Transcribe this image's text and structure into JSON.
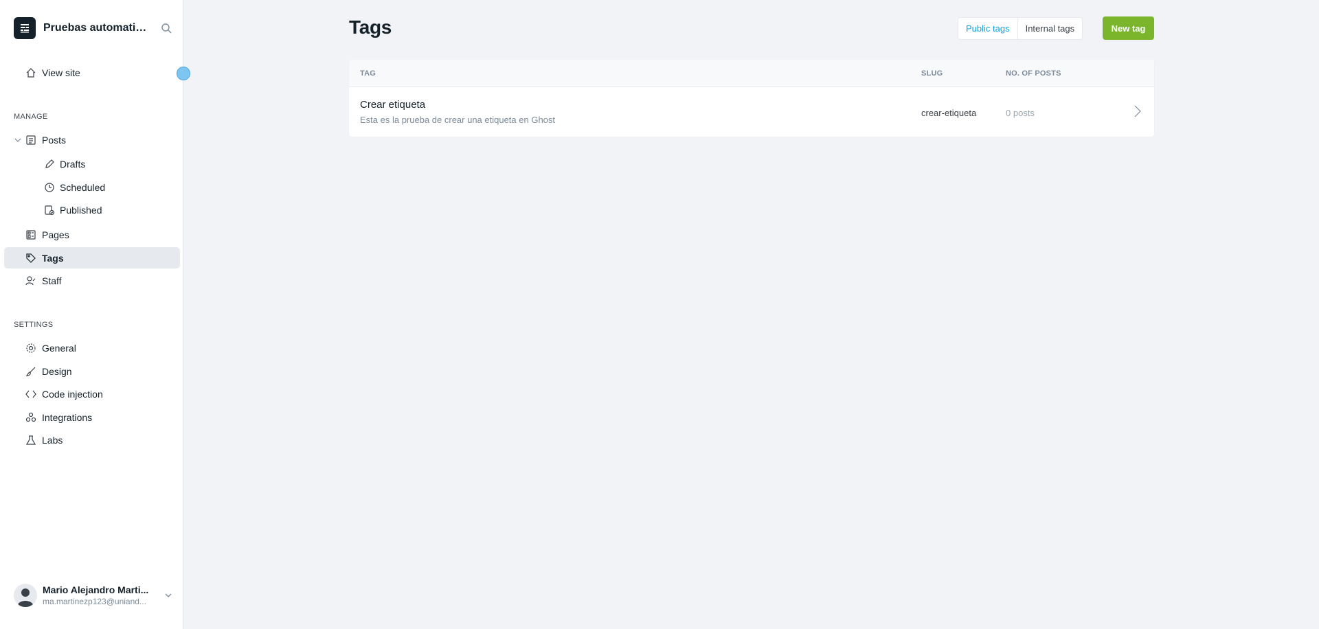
{
  "sidebar": {
    "site_title": "Pruebas automatiz...",
    "view_site": "View site",
    "manage_label": "MANAGE",
    "settings_label": "SETTINGS",
    "posts": "Posts",
    "drafts": "Drafts",
    "scheduled": "Scheduled",
    "published": "Published",
    "pages": "Pages",
    "tags": "Tags",
    "staff": "Staff",
    "general": "General",
    "design": "Design",
    "code_injection": "Code injection",
    "integrations": "Integrations",
    "labs": "Labs",
    "user": {
      "name": "Mario Alejandro Marti...",
      "email": "ma.martinezp123@uniand..."
    }
  },
  "header": {
    "title": "Tags",
    "public_tags": "Public tags",
    "internal_tags": "Internal tags",
    "new_tag": "New tag"
  },
  "table": {
    "columns": {
      "tag": "TAG",
      "slug": "SLUG",
      "posts": "NO. OF POSTS"
    },
    "rows": [
      {
        "name": "Crear etiqueta",
        "description": "Esta es la prueba de crear una etiqueta en Ghost",
        "slug": "crear-etiqueta",
        "count": "0 posts"
      }
    ]
  },
  "colors": {
    "accent": "#14a0e0",
    "primary_button": "#7ab52c",
    "sidebar_active": "#e6eaef",
    "background": "#f1f3f7"
  },
  "icons": [
    "ghost-logo-icon",
    "search-icon",
    "home-icon",
    "posts-icon",
    "pencil-icon",
    "clock-icon",
    "published-icon",
    "pages-icon",
    "tag-icon",
    "staff-icon",
    "gear-icon",
    "brush-icon",
    "code-icon",
    "integrations-icon",
    "labs-icon",
    "chevron-down-icon",
    "chevron-right-icon"
  ]
}
